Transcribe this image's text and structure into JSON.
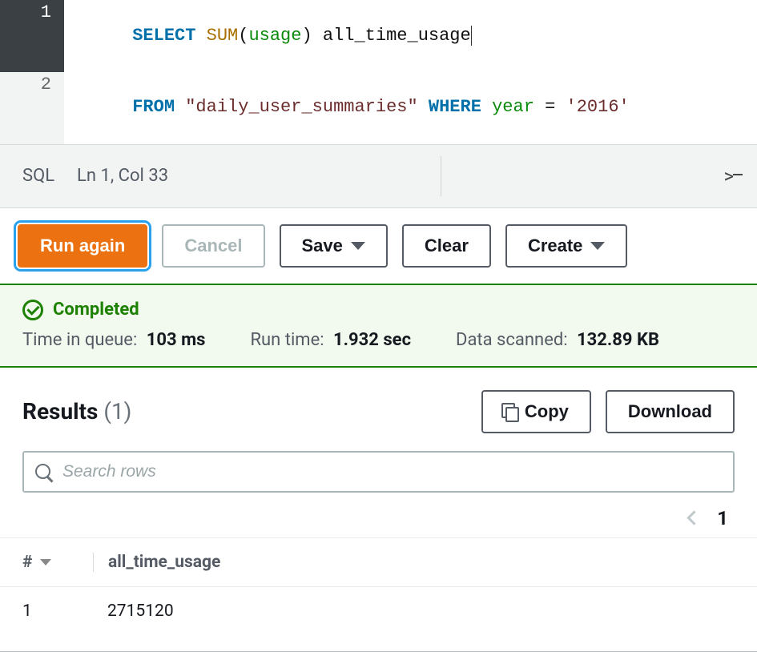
{
  "editor": {
    "lines": [
      1,
      2
    ],
    "code": {
      "l1k1": "SELECT",
      "l1f1": "SUM",
      "l1p1": "(",
      "l1id1": "usage",
      "l1p2": ")",
      "l1a1": " all_time_usage",
      "l2k1": "FROM",
      "l2s1": "\"daily_user_summaries\"",
      "l2k2": "WHERE",
      "l2id2": " year ",
      "l2eq": "=",
      "l2s2": " '2016'"
    }
  },
  "statusbar": {
    "language": "SQL",
    "position": "Ln 1, Col 33"
  },
  "toolbar": {
    "run": "Run again",
    "cancel": "Cancel",
    "save": "Save",
    "clear": "Clear",
    "create": "Create"
  },
  "banner": {
    "status": "Completed",
    "metrics": {
      "queue_label": "Time in queue:",
      "queue_value": "103 ms",
      "runtime_label": "Run time:",
      "runtime_value": "1.932 sec",
      "scanned_label": "Data scanned:",
      "scanned_value": "132.89 KB"
    }
  },
  "results": {
    "title": "Results",
    "count": "(1)",
    "copy": "Copy",
    "download": "Download",
    "search_placeholder": "Search rows",
    "page": "1",
    "columns": {
      "idx": "#",
      "c0": "all_time_usage"
    },
    "rows": [
      {
        "idx": "1",
        "c0": "2715120"
      }
    ]
  }
}
